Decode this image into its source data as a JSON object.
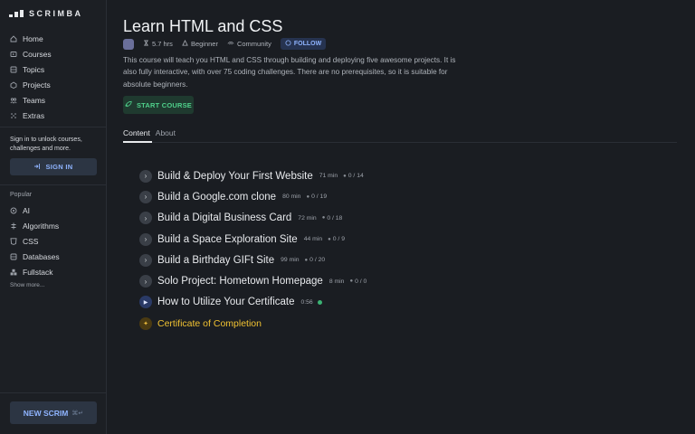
{
  "sidebar": {
    "logo_text": "SCRIMBA",
    "nav": [
      {
        "label": "Home",
        "icon": "home-icon"
      },
      {
        "label": "Courses",
        "icon": "courses-icon"
      },
      {
        "label": "Topics",
        "icon": "topics-icon"
      },
      {
        "label": "Projects",
        "icon": "projects-icon"
      },
      {
        "label": "Teams",
        "icon": "teams-icon"
      },
      {
        "label": "Extras",
        "icon": "extras-icon"
      }
    ],
    "signin_text": "Sign in to unlock courses, challenges and more.",
    "signin_button": "SIGN IN",
    "popular_label": "Popular",
    "popular": [
      {
        "label": "AI",
        "icon": "ai-icon"
      },
      {
        "label": "Algorithms",
        "icon": "algorithms-icon"
      },
      {
        "label": "CSS",
        "icon": "css-icon"
      },
      {
        "label": "Databases",
        "icon": "databases-icon"
      },
      {
        "label": "Fullstack",
        "icon": "fullstack-icon"
      }
    ],
    "show_more": "Show more...",
    "new_scrim": "NEW SCRIM",
    "new_scrim_shortcut": "⌘↵"
  },
  "course": {
    "title": "Learn HTML and CSS",
    "duration": "5.7 hrs",
    "level": "Beginner",
    "access": "Community",
    "follow": "FOLLOW",
    "description": "This course will teach you HTML and CSS through building and deploying five awesome projects. It is also fully interactive, with over 75 coding challenges. There are no prerequisites, so it is suitable for absolute beginners.",
    "start_button": "START COURSE"
  },
  "tabs": {
    "content": "Content",
    "about": "About"
  },
  "lessons": [
    {
      "title": "Build & Deploy Your First Website",
      "duration": "71 min",
      "challenges": "0 / 14"
    },
    {
      "title": "Build a Google.com clone",
      "duration": "80 min",
      "challenges": "0 / 19"
    },
    {
      "title": "Build a Digital Business Card",
      "duration": "72 min",
      "challenges": "0 / 18"
    },
    {
      "title": "Build a Space Exploration Site",
      "duration": "44 min",
      "challenges": "0 / 9"
    },
    {
      "title": "Build a Birthday GIFt Site",
      "duration": "99 min",
      "challenges": "0 / 20"
    },
    {
      "title": "Solo Project: Hometown Homepage",
      "duration": "8 min",
      "challenges": "0 / 0"
    },
    {
      "title": "How to Utilize Your Certificate",
      "duration": "0:56"
    },
    {
      "title": "Certificate of Completion"
    }
  ],
  "colors": {
    "accent_blue": "#8fb4ff",
    "start_green": "#4fd18b",
    "gold": "#f1c232"
  }
}
